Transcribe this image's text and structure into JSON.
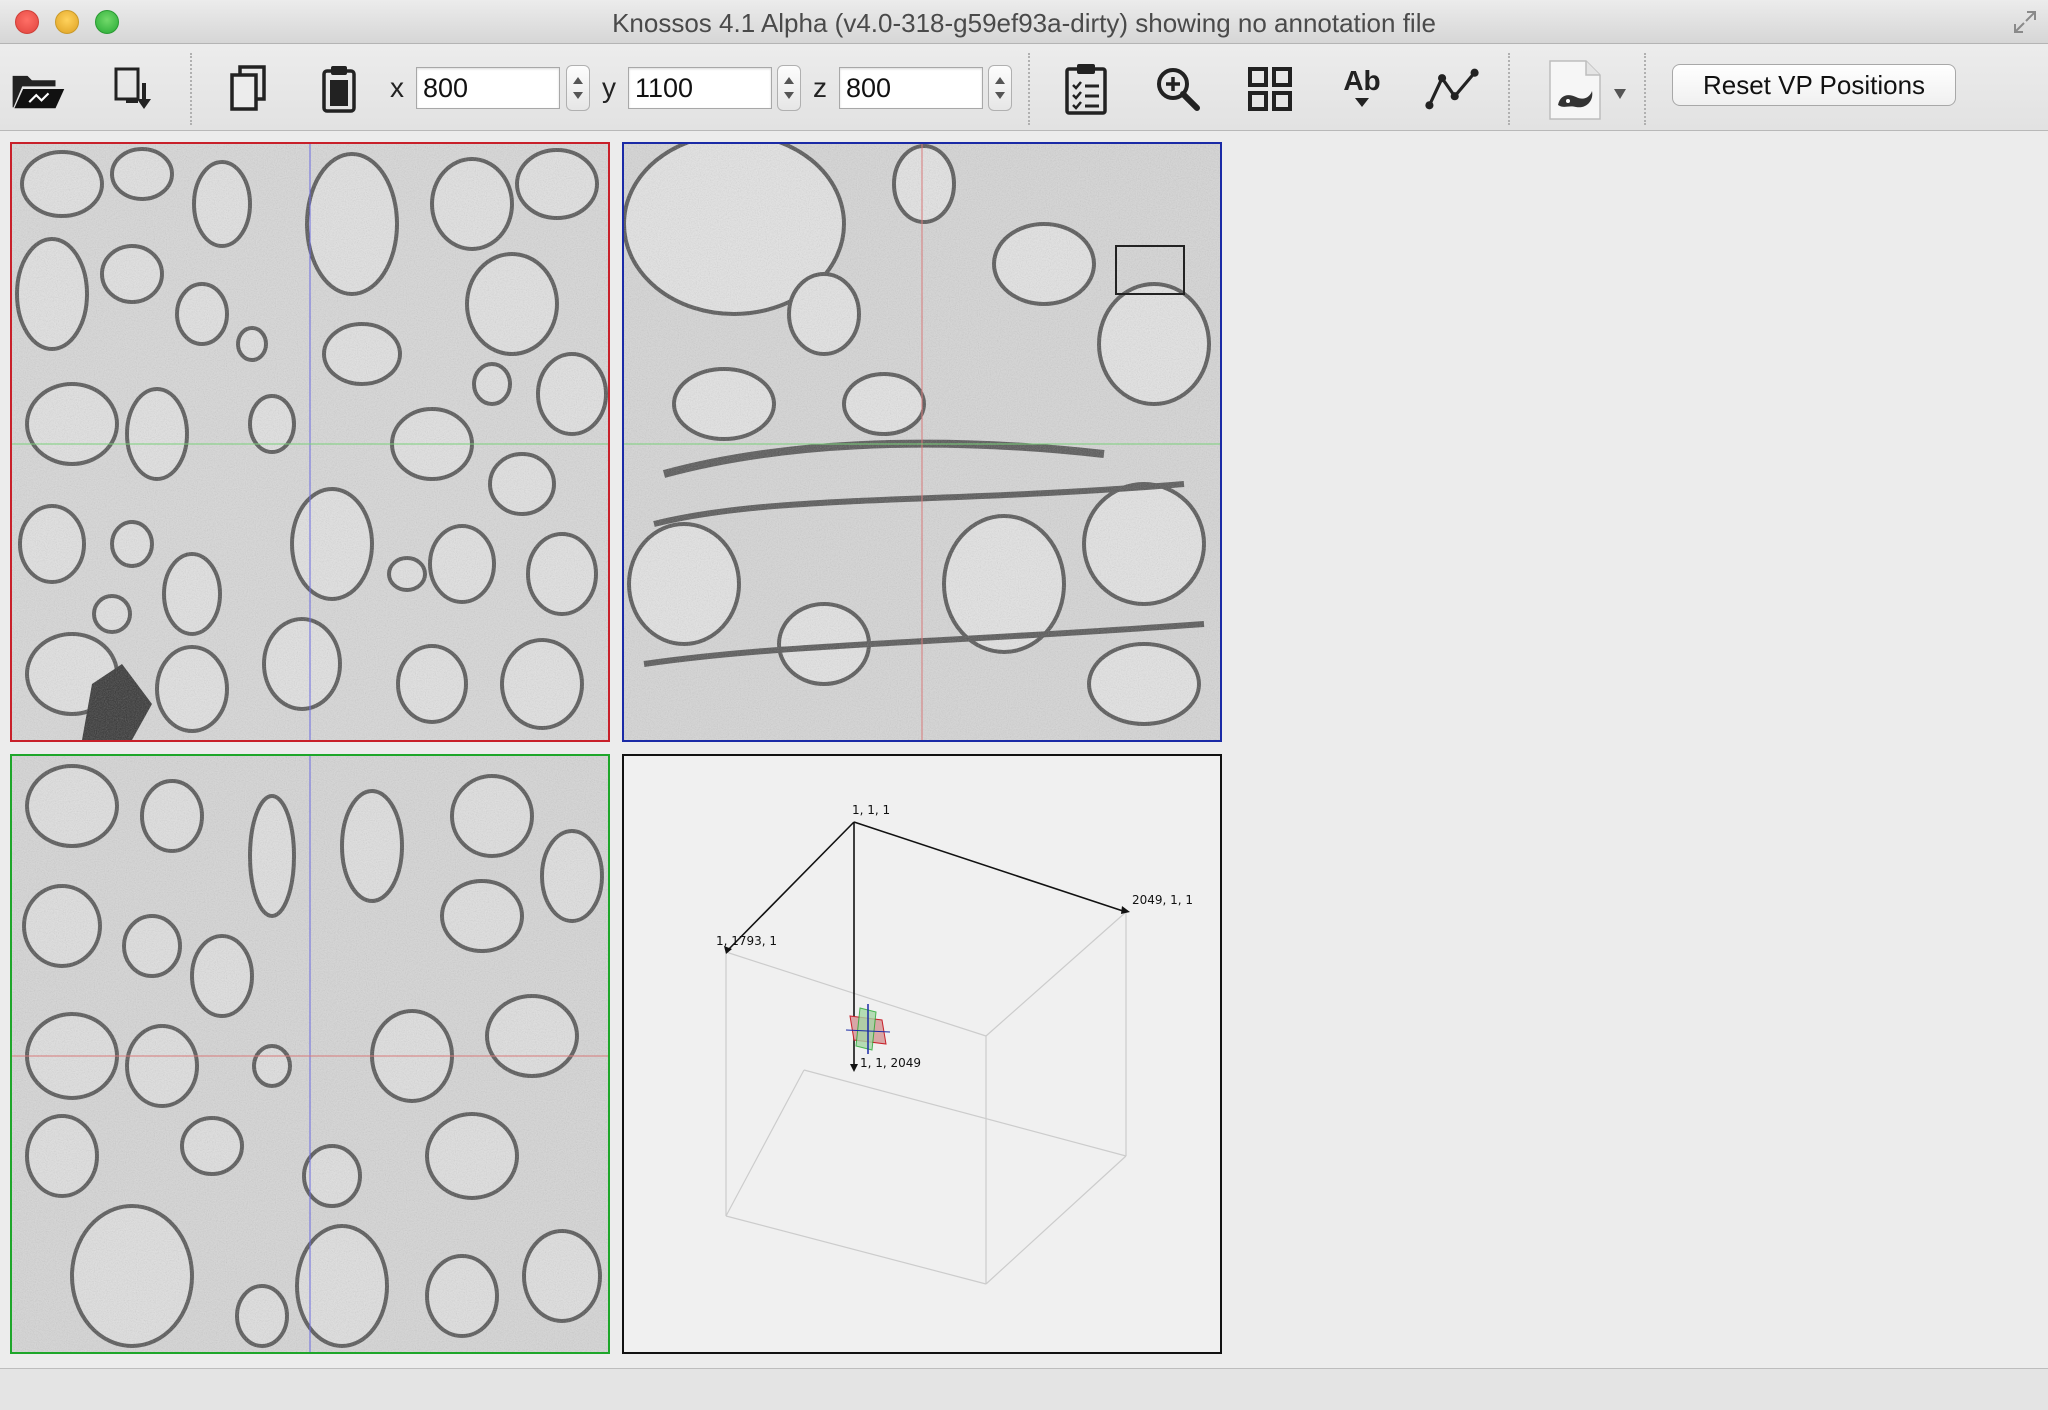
{
  "window": {
    "title": "Knossos 4.1 Alpha (v4.0-318-g59ef93a-dirty) showing no annotation file"
  },
  "toolbar": {
    "coords": {
      "x_label": "x",
      "x_value": "800",
      "y_label": "y",
      "y_value": "1100",
      "z_label": "z",
      "z_value": "800"
    },
    "text_mode_label": "Ab",
    "reset_label": "Reset VP Positions"
  },
  "viewports": {
    "xy_color": "#c8202a",
    "xz_color": "#1a2aa6",
    "zy_color": "#1ea62a",
    "skeleton3d": {
      "corner_origin": "1, 1, 1",
      "corner_x": "2049, 1, 1",
      "corner_y": "1, 1793, 1",
      "corner_z": "1, 1, 2049"
    }
  }
}
